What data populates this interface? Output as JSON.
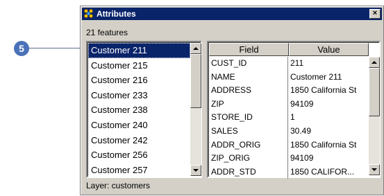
{
  "callout": {
    "number": "5"
  },
  "window": {
    "title": "Attributes",
    "close_label": "×",
    "features_count": "21 features",
    "status": "Layer: customers"
  },
  "customer_list": {
    "items": [
      "Customer  211",
      "Customer  215",
      "Customer  216",
      "Customer  233",
      "Customer  238",
      "Customer  240",
      "Customer  242",
      "Customer  256",
      "Customer  257"
    ],
    "selected_index": 0
  },
  "attribute_grid": {
    "columns": [
      "Field",
      "Value"
    ],
    "rows": [
      {
        "field": "CUST_ID",
        "value": "211"
      },
      {
        "field": "NAME",
        "value": "Customer  211"
      },
      {
        "field": "ADDRESS",
        "value": "1850 California St"
      },
      {
        "field": "ZIP",
        "value": "94109"
      },
      {
        "field": "STORE_ID",
        "value": "1"
      },
      {
        "field": "SALES",
        "value": "30.49"
      },
      {
        "field": "ADDR_ORIG",
        "value": "1850 California St"
      },
      {
        "field": "ZIP_ORIG",
        "value": "94109"
      },
      {
        "field": "ADDR_STD",
        "value": "1850 CALIFOR..."
      }
    ]
  },
  "icons": {
    "title": "customers-layer-icon",
    "close": "close-icon",
    "scroll_up": "arrow-up-icon",
    "scroll_down": "arrow-down-icon"
  },
  "colors": {
    "titlebar": "#0a246a",
    "selection": "#0a246a",
    "callout": "#4a72b8",
    "window_face": "#d4d0c8"
  }
}
